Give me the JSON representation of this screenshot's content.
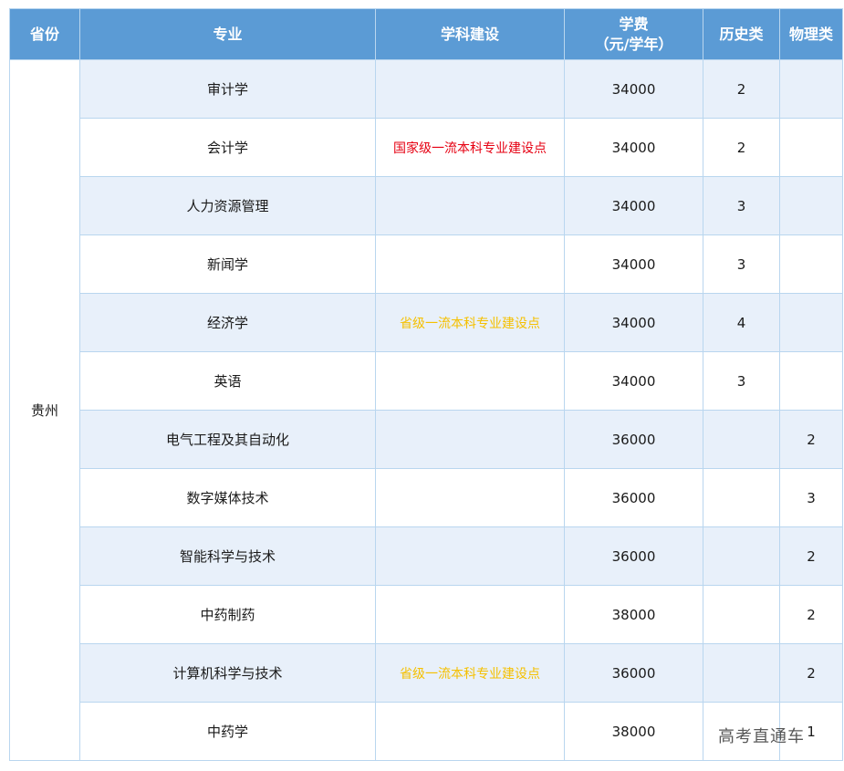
{
  "header": {
    "province": "省份",
    "major": "专业",
    "discipline": "学科建设",
    "tuition_line1": "学费",
    "tuition_line2": "（元/学年）",
    "history": "历史类",
    "physics": "物理类"
  },
  "province": "贵州",
  "rows": [
    {
      "major": "审计学",
      "discipline": "",
      "discipline_level": "",
      "tuition": "34000",
      "history": "2",
      "physics": ""
    },
    {
      "major": "会计学",
      "discipline": "国家级一流本科专业建设点",
      "discipline_level": "national",
      "tuition": "34000",
      "history": "2",
      "physics": ""
    },
    {
      "major": "人力资源管理",
      "discipline": "",
      "discipline_level": "",
      "tuition": "34000",
      "history": "3",
      "physics": ""
    },
    {
      "major": "新闻学",
      "discipline": "",
      "discipline_level": "",
      "tuition": "34000",
      "history": "3",
      "physics": ""
    },
    {
      "major": "经济学",
      "discipline": "省级一流本科专业建设点",
      "discipline_level": "provincial",
      "tuition": "34000",
      "history": "4",
      "physics": ""
    },
    {
      "major": "英语",
      "discipline": "",
      "discipline_level": "",
      "tuition": "34000",
      "history": "3",
      "physics": ""
    },
    {
      "major": "电气工程及其自动化",
      "discipline": "",
      "discipline_level": "",
      "tuition": "36000",
      "history": "",
      "physics": "2"
    },
    {
      "major": "数字媒体技术",
      "discipline": "",
      "discipline_level": "",
      "tuition": "36000",
      "history": "",
      "physics": "3"
    },
    {
      "major": "智能科学与技术",
      "discipline": "",
      "discipline_level": "",
      "tuition": "36000",
      "history": "",
      "physics": "2"
    },
    {
      "major": "中药制药",
      "discipline": "",
      "discipline_level": "",
      "tuition": "38000",
      "history": "",
      "physics": "2"
    },
    {
      "major": "计算机科学与技术",
      "discipline": "省级一流本科专业建设点",
      "discipline_level": "provincial",
      "tuition": "36000",
      "history": "",
      "physics": "2"
    },
    {
      "major": "中药学",
      "discipline": "",
      "discipline_level": "",
      "tuition": "38000",
      "history": "",
      "physics": "1"
    }
  ],
  "colors": {
    "header_bg": "#5b9bd5",
    "stripe_bg": "#e8f0fa",
    "national": "#e60012",
    "provincial": "#f5c000"
  },
  "watermark": "高考直通车"
}
